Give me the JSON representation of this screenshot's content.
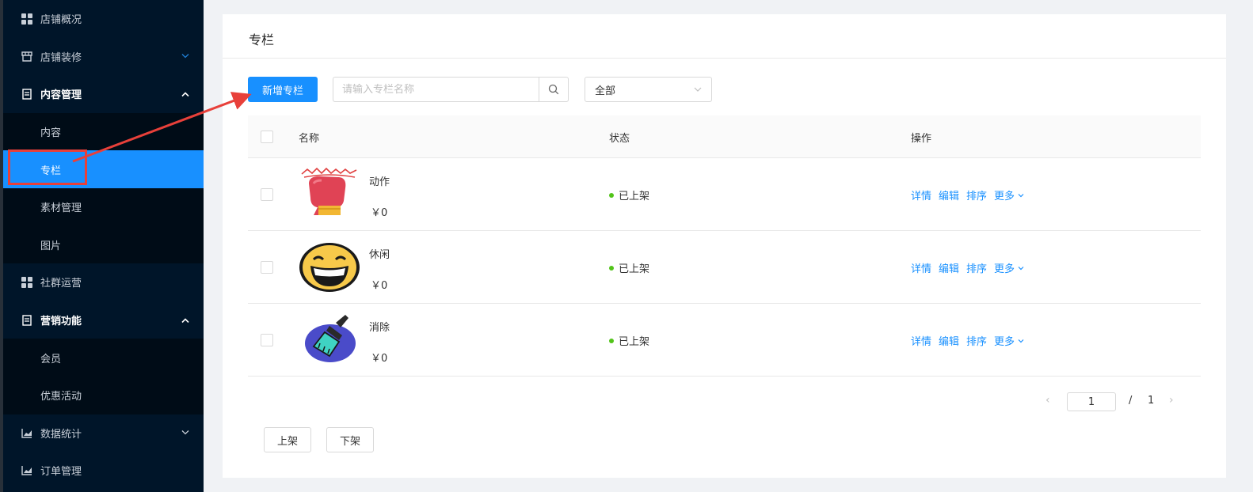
{
  "sidebar": {
    "items": [
      {
        "label": "店铺概况",
        "icon": "grid-icon"
      },
      {
        "label": "店铺装修",
        "icon": "store-icon"
      },
      {
        "label": "内容管理",
        "icon": "doc-icon"
      },
      {
        "label": "内容"
      },
      {
        "label": "专栏"
      },
      {
        "label": "素材管理"
      },
      {
        "label": "图片"
      },
      {
        "label": "社群运营",
        "icon": "grid-icon"
      },
      {
        "label": "营销功能",
        "icon": "doc-icon"
      },
      {
        "label": "会员"
      },
      {
        "label": "优惠活动"
      },
      {
        "label": "数据统计",
        "icon": "chart-icon"
      },
      {
        "label": "订单管理",
        "icon": "chart-icon"
      }
    ]
  },
  "page": {
    "title": "专栏",
    "add_button": "新增专栏",
    "search_placeholder": "请输入专栏名称",
    "filter_value": "全部"
  },
  "table": {
    "headers": {
      "name": "名称",
      "status": "状态",
      "ops": "操作"
    },
    "rows": [
      {
        "name": "动作",
        "price": "￥0",
        "status": "已上架",
        "thumb": "boxing-glove-icon"
      },
      {
        "name": "休闲",
        "price": "￥0",
        "status": "已上架",
        "thumb": "smiley-face-icon"
      },
      {
        "name": "消除",
        "price": "￥0",
        "status": "已上架",
        "thumb": "brush-icon"
      }
    ],
    "ops": {
      "detail": "详情",
      "edit": "编辑",
      "sort": "排序",
      "more": "更多"
    }
  },
  "pagination": {
    "current": "1",
    "separator": "/",
    "total": "1"
  },
  "bottom": {
    "up_button": "上架",
    "down_button": "下架"
  },
  "colors": {
    "primary": "#1890ff",
    "sidebar_bg": "#001529",
    "status_dot": "#52c41a",
    "annotation": "#e8403a"
  }
}
